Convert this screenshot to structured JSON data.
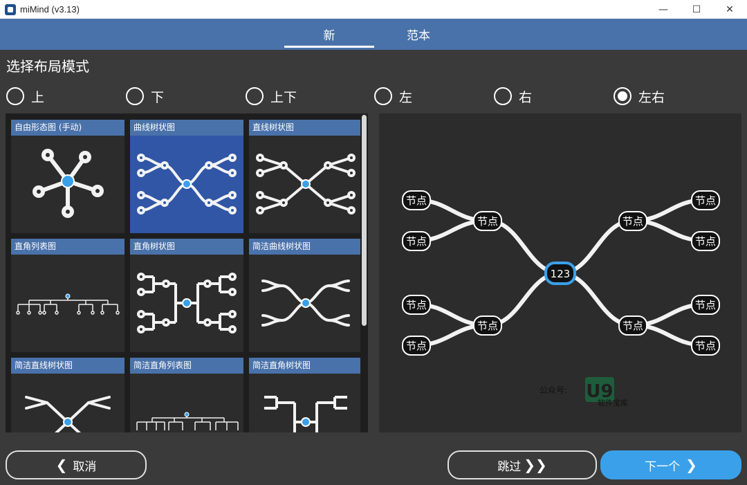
{
  "window": {
    "title": "miMind (v3.13)"
  },
  "tabs": [
    {
      "label": "新",
      "active": true
    },
    {
      "label": "范本",
      "active": false
    }
  ],
  "section_title": "选择布局模式",
  "radios": [
    {
      "label": "上",
      "checked": false
    },
    {
      "label": "下",
      "checked": false
    },
    {
      "label": "上下",
      "checked": false
    },
    {
      "label": "左",
      "checked": false
    },
    {
      "label": "右",
      "checked": false
    },
    {
      "label": "左右",
      "checked": true
    }
  ],
  "layouts": [
    {
      "label": "自由形态图 (手动)",
      "selected": false
    },
    {
      "label": "曲线树状图",
      "selected": true
    },
    {
      "label": "直线树状图",
      "selected": false
    },
    {
      "label": "直角列表图",
      "selected": false
    },
    {
      "label": "直角树状图",
      "selected": false
    },
    {
      "label": "简洁曲线树状图",
      "selected": false
    },
    {
      "label": "简洁直线树状图",
      "selected": false
    },
    {
      "label": "简洁直角列表图",
      "selected": false
    },
    {
      "label": "简洁直角树状图",
      "selected": false
    }
  ],
  "preview": {
    "root_label": "123",
    "node_label": "节点",
    "watermark": {
      "prefix": "公众号:",
      "brand": "U9",
      "subtitle": "软件宝库"
    }
  },
  "buttons": {
    "cancel": "取消",
    "skip": "跳过",
    "next": "下一个"
  },
  "colors": {
    "accent": "#3aa0ea",
    "tab_bar": "#4a72aa",
    "selected_tile": "#3156a6",
    "background": "#3a3a3a"
  }
}
